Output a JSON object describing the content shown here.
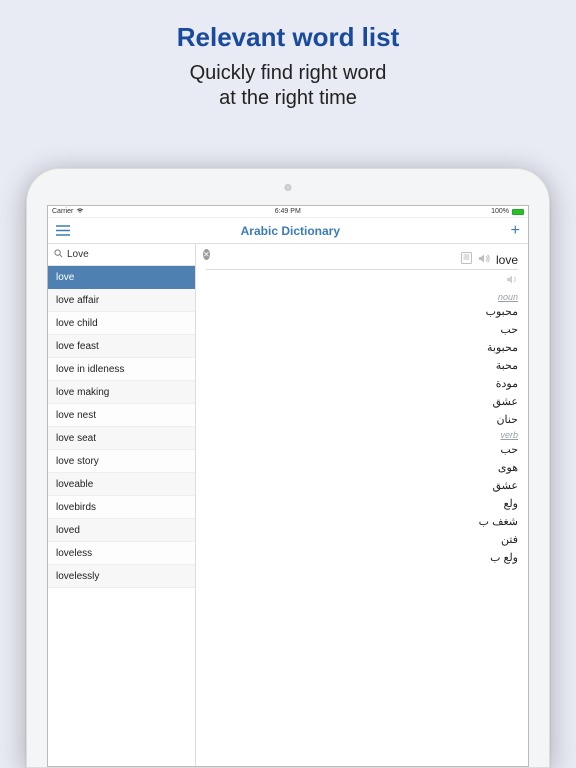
{
  "promo": {
    "title": "Relevant word list",
    "sub_line1": "Quickly find right word",
    "sub_line2": "at the right time"
  },
  "statusbar": {
    "carrier": "Carrier",
    "time": "6:49 PM",
    "battery": "100%"
  },
  "nav": {
    "title": "Arabic Dictionary"
  },
  "search": {
    "value": "Love"
  },
  "word_list": [
    "love",
    "love affair",
    "love child",
    "love feast",
    "love in idleness",
    "love making",
    "love nest",
    "love seat",
    "love story",
    "loveable",
    "lovebirds",
    "loved",
    "loveless",
    "lovelessly"
  ],
  "selected_index": 0,
  "detail": {
    "headword": "love",
    "pos1": "noun",
    "noun_translations": [
      "محبوب",
      "حب",
      "محبوبة",
      "محبة",
      "مودة",
      "عشق",
      "حنان"
    ],
    "pos2": "verb",
    "verb_translations": [
      "حب",
      "هوى",
      "عشق",
      "ولع",
      "شغف ب",
      "فتن",
      "ولع ب"
    ]
  }
}
